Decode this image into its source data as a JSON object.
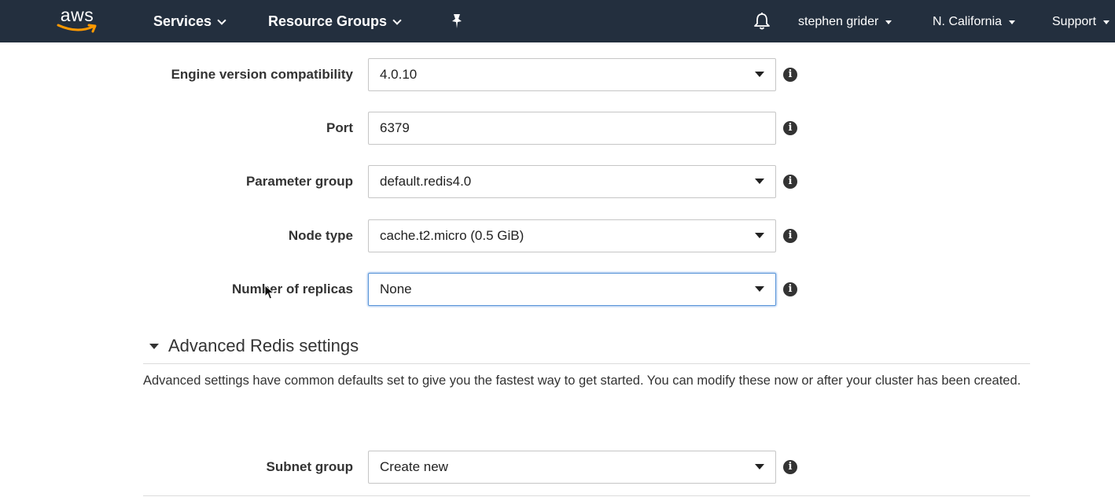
{
  "nav": {
    "logo_text": "aws",
    "services": "Services",
    "resource_groups": "Resource Groups",
    "user": "stephen grider",
    "region": "N. California",
    "support": "Support"
  },
  "form": {
    "engine_version": {
      "label": "Engine version compatibility",
      "value": "4.0.10"
    },
    "port": {
      "label": "Port",
      "value": "6379"
    },
    "parameter_group": {
      "label": "Parameter group",
      "value": "default.redis4.0"
    },
    "node_type": {
      "label": "Node type",
      "value": "cache.t2.micro (0.5 GiB)"
    },
    "replicas": {
      "label": "Number of replicas",
      "value": "None"
    }
  },
  "advanced": {
    "title": "Advanced Redis settings",
    "description": "Advanced settings have common defaults set to give you the fastest way to get started. You can modify these now or after your cluster has been created.",
    "subnet_group": {
      "label": "Subnet group",
      "value": "Create new"
    }
  },
  "icons": {
    "info": "i",
    "accent": "#ff9900",
    "nav_bg": "#232f3e"
  }
}
